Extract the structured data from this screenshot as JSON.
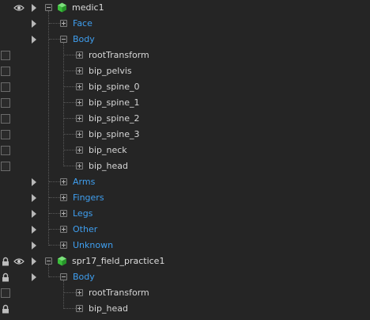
{
  "tree": {
    "rows": [
      {
        "label": "medic1",
        "kind": "root",
        "depth": 0,
        "expanded": true,
        "eye": true,
        "arrow": true,
        "lock": false,
        "checkbox": false,
        "cube": true
      },
      {
        "label": "Face",
        "kind": "group",
        "depth": 1,
        "expanded": false,
        "eye": false,
        "arrow": true,
        "lock": false,
        "checkbox": false
      },
      {
        "label": "Body",
        "kind": "group",
        "depth": 1,
        "expanded": true,
        "eye": false,
        "arrow": true,
        "lock": false,
        "checkbox": false
      },
      {
        "label": "rootTransform",
        "kind": "bone",
        "depth": 2,
        "expanded": false,
        "eye": false,
        "arrow": false,
        "lock": false,
        "checkbox": true
      },
      {
        "label": "bip_pelvis",
        "kind": "bone",
        "depth": 2,
        "expanded": false,
        "eye": false,
        "arrow": false,
        "lock": false,
        "checkbox": true
      },
      {
        "label": "bip_spine_0",
        "kind": "bone",
        "depth": 2,
        "expanded": false,
        "eye": false,
        "arrow": false,
        "lock": false,
        "checkbox": true
      },
      {
        "label": "bip_spine_1",
        "kind": "bone",
        "depth": 2,
        "expanded": false,
        "eye": false,
        "arrow": false,
        "lock": false,
        "checkbox": true
      },
      {
        "label": "bip_spine_2",
        "kind": "bone",
        "depth": 2,
        "expanded": false,
        "eye": false,
        "arrow": false,
        "lock": false,
        "checkbox": true
      },
      {
        "label": "bip_spine_3",
        "kind": "bone",
        "depth": 2,
        "expanded": false,
        "eye": false,
        "arrow": false,
        "lock": false,
        "checkbox": true
      },
      {
        "label": "bip_neck",
        "kind": "bone",
        "depth": 2,
        "expanded": false,
        "eye": false,
        "arrow": false,
        "lock": false,
        "checkbox": true
      },
      {
        "label": "bip_head",
        "kind": "bone",
        "depth": 2,
        "expanded": false,
        "eye": false,
        "arrow": false,
        "lock": false,
        "checkbox": true
      },
      {
        "label": "Arms",
        "kind": "group",
        "depth": 1,
        "expanded": false,
        "eye": false,
        "arrow": true,
        "lock": false,
        "checkbox": false
      },
      {
        "label": "Fingers",
        "kind": "group",
        "depth": 1,
        "expanded": false,
        "eye": false,
        "arrow": true,
        "lock": false,
        "checkbox": false
      },
      {
        "label": "Legs",
        "kind": "group",
        "depth": 1,
        "expanded": false,
        "eye": false,
        "arrow": true,
        "lock": false,
        "checkbox": false
      },
      {
        "label": "Other",
        "kind": "group",
        "depth": 1,
        "expanded": false,
        "eye": false,
        "arrow": true,
        "lock": false,
        "checkbox": false
      },
      {
        "label": "Unknown",
        "kind": "group",
        "depth": 1,
        "expanded": false,
        "eye": false,
        "arrow": true,
        "lock": false,
        "checkbox": false
      },
      {
        "label": "spr17_field_practice1",
        "kind": "root",
        "depth": 0,
        "expanded": true,
        "eye": true,
        "arrow": true,
        "lock": true,
        "checkbox": false,
        "cube": true
      },
      {
        "label": "Body",
        "kind": "group",
        "depth": 1,
        "expanded": true,
        "eye": false,
        "arrow": true,
        "lock": true,
        "checkbox": false
      },
      {
        "label": "rootTransform",
        "kind": "bone",
        "depth": 2,
        "expanded": false,
        "eye": false,
        "arrow": false,
        "lock": false,
        "checkbox": true
      },
      {
        "label": "bip_head",
        "kind": "bone",
        "depth": 2,
        "expanded": false,
        "eye": false,
        "arrow": false,
        "lock": true,
        "checkbox": false
      }
    ]
  },
  "colors": {
    "background": "#252525",
    "group_text": "#3f9ff0",
    "item_text": "#d6d6d6",
    "cube_green": "#3bbf3b"
  },
  "icons": {
    "eye": "eye-icon",
    "lock": "lock-icon",
    "arrow": "play-arrow-icon",
    "cube": "cube-icon",
    "checkbox": "checkbox-icon",
    "expander": "tree-expander-icon"
  }
}
